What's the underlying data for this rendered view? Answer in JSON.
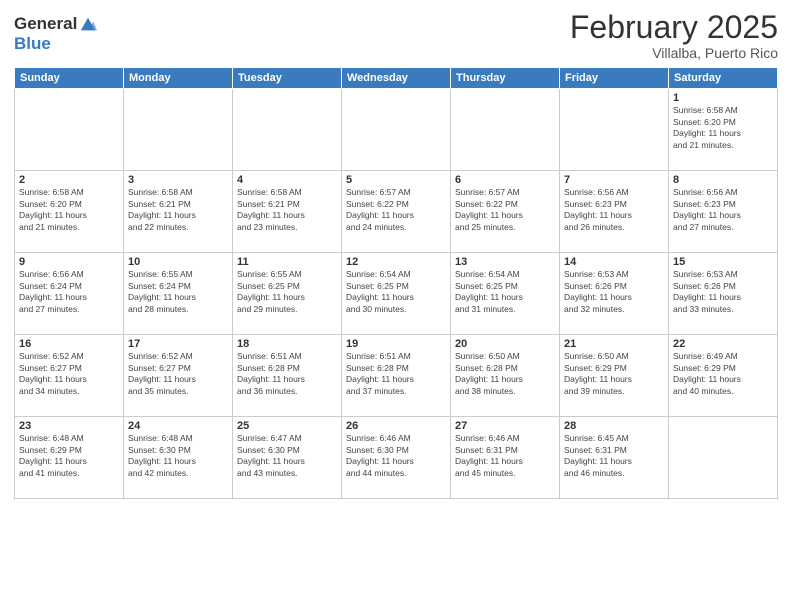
{
  "header": {
    "logo_general": "General",
    "logo_blue": "Blue",
    "month_title": "February 2025",
    "location": "Villalba, Puerto Rico"
  },
  "days_of_week": [
    "Sunday",
    "Monday",
    "Tuesday",
    "Wednesday",
    "Thursday",
    "Friday",
    "Saturday"
  ],
  "weeks": [
    [
      {
        "day": "",
        "info": ""
      },
      {
        "day": "",
        "info": ""
      },
      {
        "day": "",
        "info": ""
      },
      {
        "day": "",
        "info": ""
      },
      {
        "day": "",
        "info": ""
      },
      {
        "day": "",
        "info": ""
      },
      {
        "day": "1",
        "info": "Sunrise: 6:58 AM\nSunset: 6:20 PM\nDaylight: 11 hours\nand 21 minutes."
      }
    ],
    [
      {
        "day": "2",
        "info": "Sunrise: 6:58 AM\nSunset: 6:20 PM\nDaylight: 11 hours\nand 21 minutes."
      },
      {
        "day": "3",
        "info": "Sunrise: 6:58 AM\nSunset: 6:21 PM\nDaylight: 11 hours\nand 22 minutes."
      },
      {
        "day": "4",
        "info": "Sunrise: 6:58 AM\nSunset: 6:21 PM\nDaylight: 11 hours\nand 23 minutes."
      },
      {
        "day": "5",
        "info": "Sunrise: 6:57 AM\nSunset: 6:22 PM\nDaylight: 11 hours\nand 24 minutes."
      },
      {
        "day": "6",
        "info": "Sunrise: 6:57 AM\nSunset: 6:22 PM\nDaylight: 11 hours\nand 25 minutes."
      },
      {
        "day": "7",
        "info": "Sunrise: 6:56 AM\nSunset: 6:23 PM\nDaylight: 11 hours\nand 26 minutes."
      },
      {
        "day": "8",
        "info": "Sunrise: 6:56 AM\nSunset: 6:23 PM\nDaylight: 11 hours\nand 27 minutes."
      }
    ],
    [
      {
        "day": "9",
        "info": "Sunrise: 6:56 AM\nSunset: 6:24 PM\nDaylight: 11 hours\nand 27 minutes."
      },
      {
        "day": "10",
        "info": "Sunrise: 6:55 AM\nSunset: 6:24 PM\nDaylight: 11 hours\nand 28 minutes."
      },
      {
        "day": "11",
        "info": "Sunrise: 6:55 AM\nSunset: 6:25 PM\nDaylight: 11 hours\nand 29 minutes."
      },
      {
        "day": "12",
        "info": "Sunrise: 6:54 AM\nSunset: 6:25 PM\nDaylight: 11 hours\nand 30 minutes."
      },
      {
        "day": "13",
        "info": "Sunrise: 6:54 AM\nSunset: 6:25 PM\nDaylight: 11 hours\nand 31 minutes."
      },
      {
        "day": "14",
        "info": "Sunrise: 6:53 AM\nSunset: 6:26 PM\nDaylight: 11 hours\nand 32 minutes."
      },
      {
        "day": "15",
        "info": "Sunrise: 6:53 AM\nSunset: 6:26 PM\nDaylight: 11 hours\nand 33 minutes."
      }
    ],
    [
      {
        "day": "16",
        "info": "Sunrise: 6:52 AM\nSunset: 6:27 PM\nDaylight: 11 hours\nand 34 minutes."
      },
      {
        "day": "17",
        "info": "Sunrise: 6:52 AM\nSunset: 6:27 PM\nDaylight: 11 hours\nand 35 minutes."
      },
      {
        "day": "18",
        "info": "Sunrise: 6:51 AM\nSunset: 6:28 PM\nDaylight: 11 hours\nand 36 minutes."
      },
      {
        "day": "19",
        "info": "Sunrise: 6:51 AM\nSunset: 6:28 PM\nDaylight: 11 hours\nand 37 minutes."
      },
      {
        "day": "20",
        "info": "Sunrise: 6:50 AM\nSunset: 6:28 PM\nDaylight: 11 hours\nand 38 minutes."
      },
      {
        "day": "21",
        "info": "Sunrise: 6:50 AM\nSunset: 6:29 PM\nDaylight: 11 hours\nand 39 minutes."
      },
      {
        "day": "22",
        "info": "Sunrise: 6:49 AM\nSunset: 6:29 PM\nDaylight: 11 hours\nand 40 minutes."
      }
    ],
    [
      {
        "day": "23",
        "info": "Sunrise: 6:48 AM\nSunset: 6:29 PM\nDaylight: 11 hours\nand 41 minutes."
      },
      {
        "day": "24",
        "info": "Sunrise: 6:48 AM\nSunset: 6:30 PM\nDaylight: 11 hours\nand 42 minutes."
      },
      {
        "day": "25",
        "info": "Sunrise: 6:47 AM\nSunset: 6:30 PM\nDaylight: 11 hours\nand 43 minutes."
      },
      {
        "day": "26",
        "info": "Sunrise: 6:46 AM\nSunset: 6:30 PM\nDaylight: 11 hours\nand 44 minutes."
      },
      {
        "day": "27",
        "info": "Sunrise: 6:46 AM\nSunset: 6:31 PM\nDaylight: 11 hours\nand 45 minutes."
      },
      {
        "day": "28",
        "info": "Sunrise: 6:45 AM\nSunset: 6:31 PM\nDaylight: 11 hours\nand 46 minutes."
      },
      {
        "day": "",
        "info": ""
      }
    ]
  ]
}
